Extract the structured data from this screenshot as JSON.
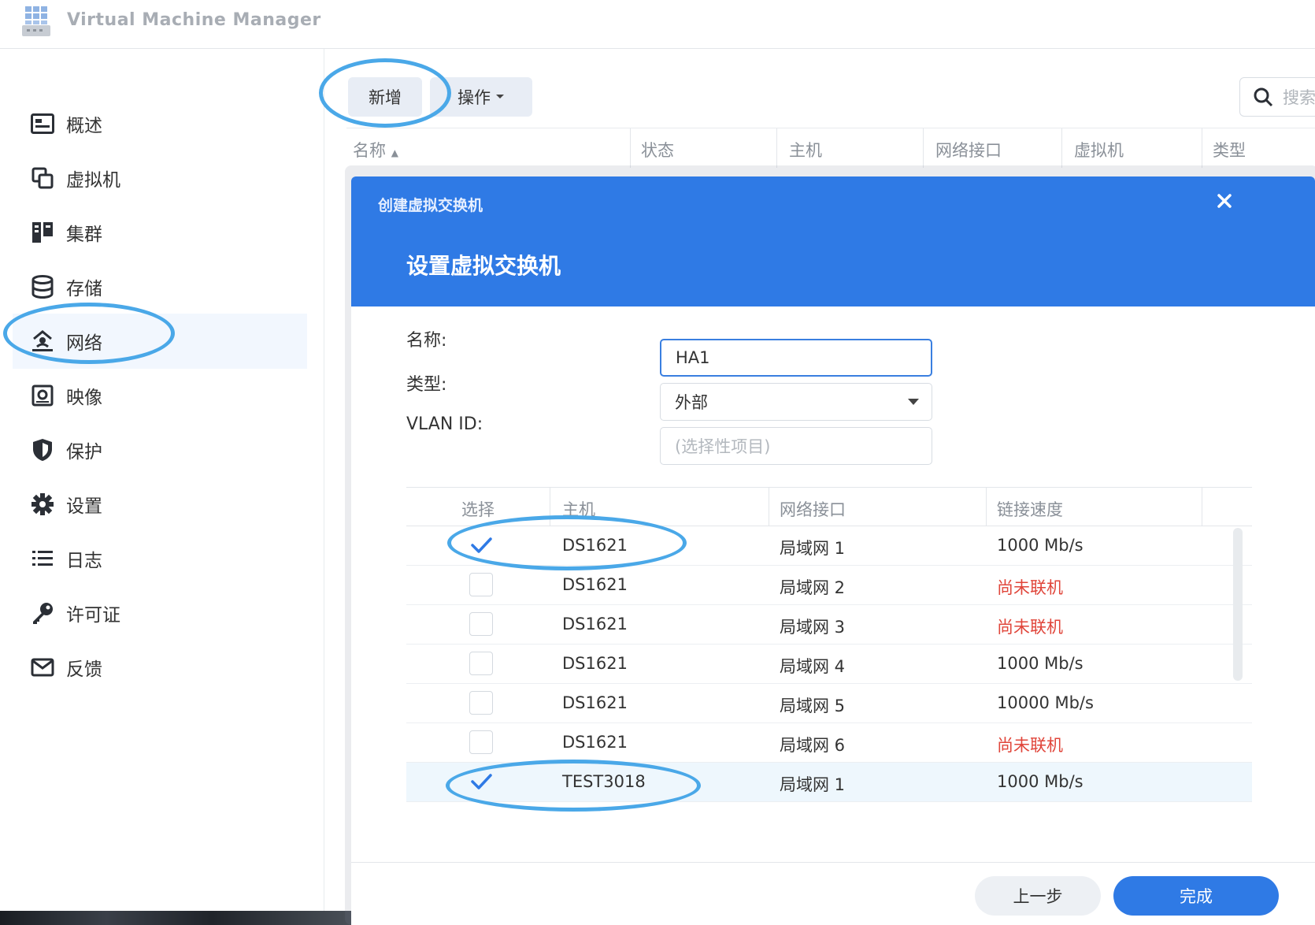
{
  "app": {
    "title": "Virtual Machine Manager",
    "icon": "vmm-app-icon"
  },
  "sidebar": {
    "items": [
      {
        "label": "概述",
        "icon": "overview-icon"
      },
      {
        "label": "虚拟机",
        "icon": "vm-icon"
      },
      {
        "label": "集群",
        "icon": "cluster-icon"
      },
      {
        "label": "存储",
        "icon": "storage-icon"
      },
      {
        "label": "网络",
        "icon": "network-icon",
        "active": true
      },
      {
        "label": "映像",
        "icon": "image-icon"
      },
      {
        "label": "保护",
        "icon": "shield-icon"
      },
      {
        "label": "设置",
        "icon": "gear-icon"
      },
      {
        "label": "日志",
        "icon": "list-icon"
      },
      {
        "label": "许可证",
        "icon": "key-icon"
      },
      {
        "label": "反馈",
        "icon": "mail-icon"
      }
    ]
  },
  "toolbar": {
    "add_label": "新增",
    "ops_label": "操作",
    "search_placeholder": "搜索"
  },
  "list": {
    "columns": [
      "名称",
      "状态",
      "主机",
      "网络接口",
      "虚拟机",
      "类型"
    ]
  },
  "modal": {
    "small_title": "创建虚拟交换机",
    "title": "设置虚拟交换机",
    "form": {
      "name_label": "名称:",
      "name_value": "HA1",
      "type_label": "类型:",
      "type_value": "外部",
      "vlan_label": "VLAN ID:",
      "vlan_placeholder": "(选择性项目)"
    },
    "table": {
      "columns": [
        "选择",
        "主机",
        "网络接口",
        "链接速度"
      ],
      "rows": [
        {
          "checked": true,
          "host": "DS1621",
          "iface": "局域网 1",
          "speed": "1000 Mb/s",
          "offline": false
        },
        {
          "checked": false,
          "host": "DS1621",
          "iface": "局域网 2",
          "speed": "尚未联机",
          "offline": true
        },
        {
          "checked": false,
          "host": "DS1621",
          "iface": "局域网 3",
          "speed": "尚未联机",
          "offline": true
        },
        {
          "checked": false,
          "host": "DS1621",
          "iface": "局域网 4",
          "speed": "1000 Mb/s",
          "offline": false
        },
        {
          "checked": false,
          "host": "DS1621",
          "iface": "局域网 5",
          "speed": "10000 Mb/s",
          "offline": false
        },
        {
          "checked": false,
          "host": "DS1621",
          "iface": "局域网 6",
          "speed": "尚未联机",
          "offline": true
        },
        {
          "checked": true,
          "host": "TEST3018",
          "iface": "局域网 1",
          "speed": "1000 Mb/s",
          "offline": false
        }
      ]
    },
    "prev_label": "上一步",
    "done_label": "完成"
  },
  "colors": {
    "accent": "#2f7ae5",
    "annotation_ring": "#4aa8e8",
    "offline_text": "#e0453a"
  }
}
